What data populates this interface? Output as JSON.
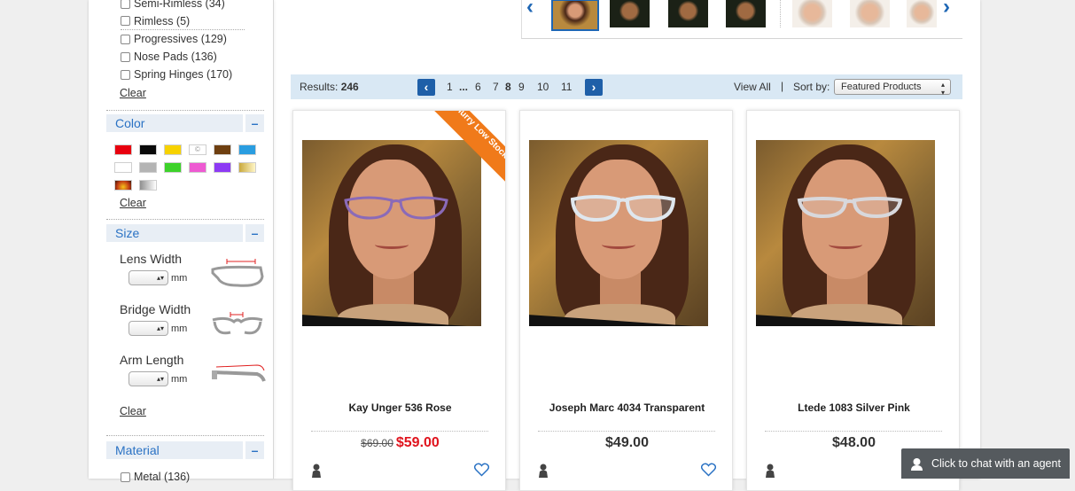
{
  "sidebar": {
    "rim_filters": [
      {
        "label": "Semi-Rimless (34)"
      },
      {
        "label": "Rimless (5)"
      },
      {
        "label": "Progressives (129)"
      },
      {
        "label": "Nose Pads (136)"
      },
      {
        "label": "Spring Hinges (170)"
      }
    ],
    "clear_label": "Clear",
    "color": {
      "title": "Color",
      "toggle": "–",
      "swatches": [
        "#e8000e",
        "#0a0a0a",
        "#f7d200",
        "#ffffff",
        "#6e3f10",
        "#2a9de0",
        "#ffffff",
        "#b4b4b4",
        "#3dd22a",
        "#ee5ad2",
        "#8d3af4",
        "#e8d690",
        "#c6461a",
        "#c9c9c9"
      ],
      "clear_label": "Clear"
    },
    "size": {
      "title": "Size",
      "toggle": "–",
      "lens_width": "Lens Width",
      "bridge_width": "Bridge Width",
      "arm_length": "Arm Length",
      "unit": "mm",
      "clear_label": "Clear"
    },
    "material": {
      "title": "Material",
      "toggle": "–",
      "first_item": "Metal (136)"
    }
  },
  "results_bar": {
    "results_label": "Results:",
    "results_count": "246",
    "pages": [
      "1",
      "...",
      "6",
      "7",
      "8",
      "9",
      "10",
      "11"
    ],
    "current_page": "8",
    "view_all": "View All",
    "divider": "|",
    "sort_label": "Sort by:",
    "sort_value": "Featured Products"
  },
  "products": [
    {
      "name": "Kay Unger 536 Rose",
      "old_price": "$69.00",
      "price": "$59.00",
      "ribbon": "Hurry Low Stock!",
      "frame_color": "#8a6ab8"
    },
    {
      "name": "Joseph Marc 4034 Transparent",
      "price": "$49.00",
      "frame_color": "#dfe7ee"
    },
    {
      "name": "Ltede 1083 Silver Pink",
      "price": "$48.00",
      "frame_color": "#d8d8dc"
    }
  ],
  "chat": {
    "label": "Click to chat with an agent"
  },
  "colors": {
    "accent_blue": "#1e66b4",
    "results_bar_bg": "#d9e8f4",
    "sale_red": "#e0141e",
    "ribbon_orange": "#f07a1a"
  }
}
